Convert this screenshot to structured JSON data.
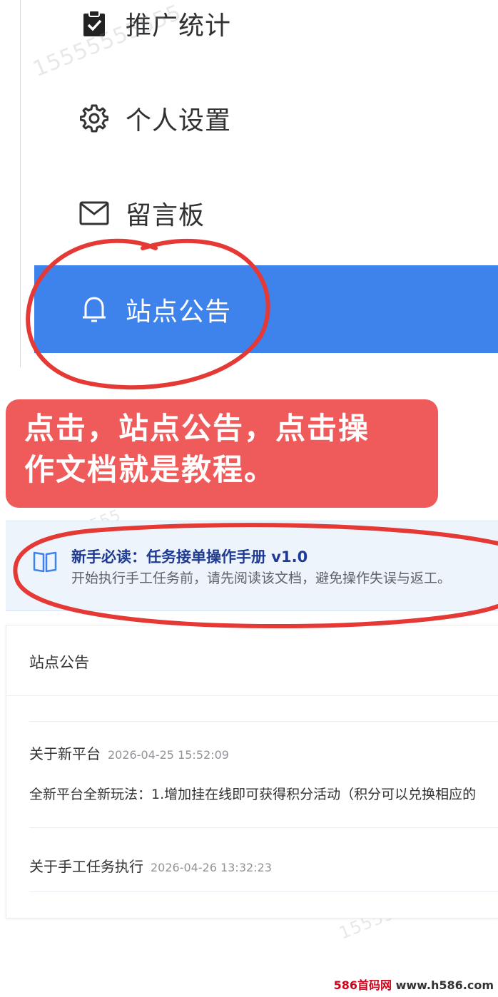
{
  "menu": {
    "items": [
      {
        "label": "推广统计",
        "icon": "clipboard-check-icon"
      },
      {
        "label": "个人设置",
        "icon": "gear-icon"
      },
      {
        "label": "留言板",
        "icon": "mail-icon"
      },
      {
        "label": "站点公告",
        "icon": "bell-icon",
        "active": true
      }
    ]
  },
  "watermark_text": "15555555555",
  "callout": {
    "line1": "点击，站点公告，点击操",
    "line2": "作文档就是教程。"
  },
  "doc_banner": {
    "icon": "book-icon",
    "title": "新手必读：任务接单操作手册 v1.0",
    "subtitle": "开始执行手工任务前，请先阅读该文档，避免操作失误与返工。"
  },
  "announcements": {
    "title": "站点公告",
    "items": [
      {
        "title": "关于新平台",
        "date": "2026-04-25 15:52:09",
        "body": "全新平台全新玩法：1.增加挂在线即可获得积分活动（积分可以兑换相应的"
      },
      {
        "title": "关于手工任务执行",
        "date": "2026-04-26 13:32:23"
      }
    ]
  },
  "footer": {
    "brand": "586首码网",
    "url": "www.h586.com"
  },
  "colors": {
    "accent": "#3e82ec",
    "callout": "#ef5a5a",
    "annotation": "#e53935"
  }
}
